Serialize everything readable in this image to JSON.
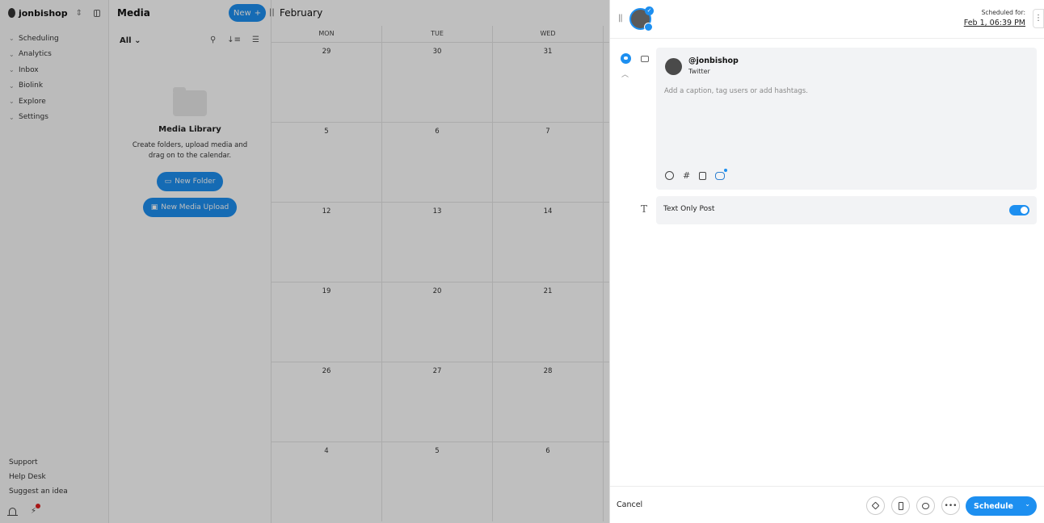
{
  "workspace": {
    "name": "jonbishop",
    "switch_icon": "updown-icon"
  },
  "sidebar": {
    "items": [
      {
        "label": "Scheduling"
      },
      {
        "label": "Analytics"
      },
      {
        "label": "Inbox"
      },
      {
        "label": "Biolink"
      },
      {
        "label": "Explore"
      },
      {
        "label": "Settings"
      }
    ],
    "footer": {
      "support": "Support",
      "help": "Help Desk",
      "suggest": "Suggest an idea"
    }
  },
  "media": {
    "title": "Media",
    "new_label": "New",
    "filter": "All",
    "empty_title": "Media Library",
    "empty_text": "Create folders, upload media and drag on to the calendar.",
    "new_folder": "New Folder",
    "new_upload": "New Media Upload"
  },
  "calendar": {
    "month": "February",
    "days": [
      "MON",
      "TUE",
      "WED"
    ],
    "weeks": [
      [
        "29",
        "30",
        "31"
      ],
      [
        "5",
        "6",
        "7"
      ],
      [
        "12",
        "13",
        "14"
      ],
      [
        "19",
        "20",
        "21"
      ],
      [
        "26",
        "27",
        "28"
      ],
      [
        "4",
        "5",
        "6"
      ]
    ]
  },
  "composer": {
    "scheduled_label": "Scheduled for:",
    "scheduled_date": "Feb 1, 06:39 PM",
    "account_handle": "@jonbishop",
    "account_network": "Twitter",
    "caption_placeholder": "Add a caption, tag users or add hashtags.",
    "text_only_label": "Text Only Post",
    "text_only_enabled": true,
    "cancel": "Cancel",
    "schedule": "Schedule",
    "more_glyph": "•••",
    "hashtag_glyph": "#"
  },
  "colors": {
    "accent": "#1d8ff0",
    "overlay": "rgba(0,0,0,0.25)",
    "notification": "#e02020"
  }
}
